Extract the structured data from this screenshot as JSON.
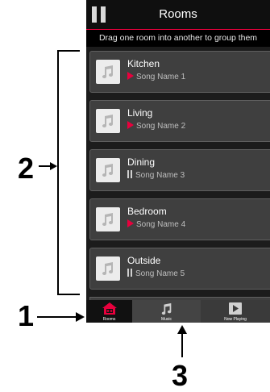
{
  "header": {
    "title": "Rooms"
  },
  "hint": "Drag one room into another to group them",
  "rooms": [
    {
      "name": "Kitchen",
      "song": "Song Name 1",
      "state": "playing"
    },
    {
      "name": "Living",
      "song": "Song Name 2",
      "state": "playing"
    },
    {
      "name": "Dining",
      "song": "Song Name 3",
      "state": "paused"
    },
    {
      "name": "Bedroom",
      "song": "Song Name 4",
      "state": "playing"
    },
    {
      "name": "Outside",
      "song": "Song Name 5",
      "state": "paused"
    }
  ],
  "tabs": [
    {
      "label": "Rooms",
      "icon": "home-speaker-icon",
      "active": true
    },
    {
      "label": "Music",
      "icon": "music-note-icon",
      "active": false
    },
    {
      "label": "Now Playing",
      "icon": "play-icon",
      "active": false
    }
  ],
  "callouts": {
    "one": "1",
    "two": "2",
    "three": "3"
  },
  "colors": {
    "accent": "#e8003d",
    "background": "#1c1c1c",
    "card": "#3f3f3f"
  }
}
